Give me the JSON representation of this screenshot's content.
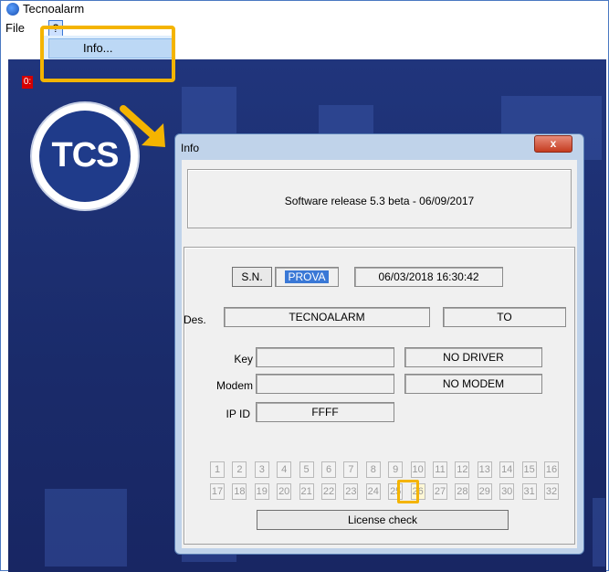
{
  "app": {
    "title": "Tecnoalarm"
  },
  "menu": {
    "file": "File",
    "help": "?",
    "dropdown_item": "Info..."
  },
  "client": {
    "indicator": "0:"
  },
  "logo": {
    "text": "TCS"
  },
  "dialog": {
    "title": "Info",
    "close": "x",
    "release_text": "Software release 5.3 beta - 06/09/2017",
    "sn_button": "S.N.",
    "sn_value": "PROVA",
    "datetime": "06/03/2018 16:30:42",
    "des_label": "Des.",
    "des_value": "TECNOALARM",
    "des_code": "TO",
    "key_label": "Key",
    "key_value": "",
    "key_status": "NO DRIVER",
    "modem_label": "Modem",
    "modem_value": "",
    "modem_status": "NO MODEM",
    "ipid_label": "IP ID",
    "ipid_value": "FFFF",
    "numbers_row1": [
      "1",
      "2",
      "3",
      "4",
      "5",
      "6",
      "7",
      "8",
      "9",
      "10",
      "11",
      "12",
      "13",
      "14",
      "15",
      "16"
    ],
    "numbers_row2": [
      "17",
      "18",
      "19",
      "20",
      "21",
      "22",
      "23",
      "24",
      "25",
      "26",
      "27",
      "28",
      "29",
      "30",
      "31",
      "32"
    ],
    "highlighted_number": "26",
    "license_button": "License check"
  },
  "colors": {
    "accent_highlight": "#f4b400",
    "app_background": "#1b2d6e",
    "selection": "#3a78d6"
  }
}
